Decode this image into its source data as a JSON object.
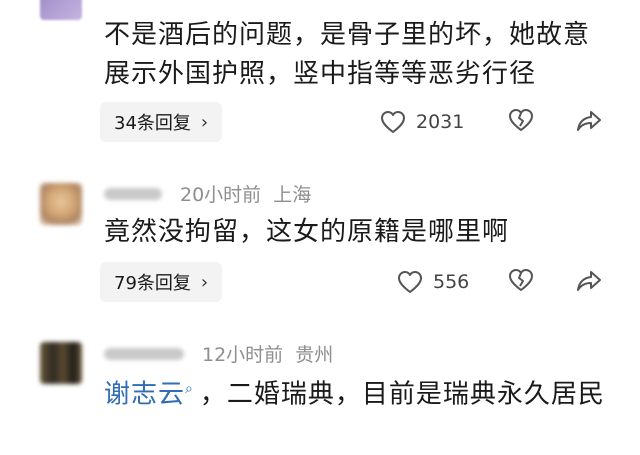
{
  "comments": [
    {
      "username": "",
      "time": "",
      "location": "",
      "text": "不是酒后的问题，是骨子里的坏，她故意展示外国护照，竖中指等等恶劣行径",
      "replies": "34条回复",
      "likes": "2031"
    },
    {
      "username": "",
      "time": "20小时前",
      "location": "上海",
      "text": "竟然没拘留，这女的原籍是哪里啊",
      "replies": "79条回复",
      "likes": "556"
    },
    {
      "username": "",
      "time": "12小时前",
      "location": "贵州",
      "mention": "谢志云",
      "text": "，二婚瑞典，目前是瑞典永久居民"
    }
  ],
  "colors": {
    "meta_gray": "#8e8e8e",
    "mention_blue": "#2f6db5",
    "reply_bg": "#f3f3f3"
  },
  "icons": {
    "like": "heart-outline-icon",
    "dislike": "broken-heart-icon",
    "share": "share-arrow-icon",
    "chevron": "chevron-right-icon",
    "mention": "search-icon"
  }
}
